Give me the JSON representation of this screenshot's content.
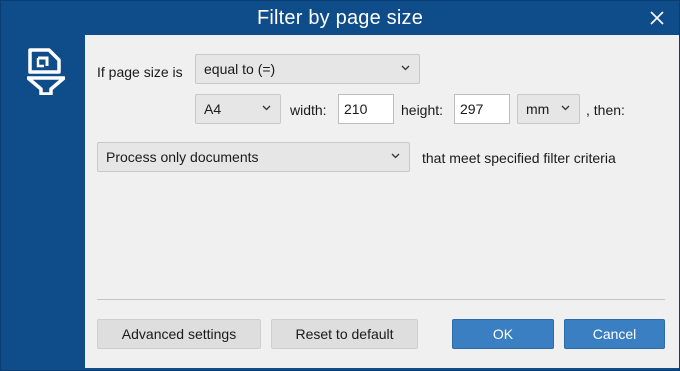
{
  "window": {
    "title": "Filter by page size",
    "accent": "#0f4c8a"
  },
  "icons": {
    "close": "close-icon",
    "app": "filter-page-icon",
    "chevron": "chevron-down-icon"
  },
  "condition": {
    "prefix_label": "If page size is",
    "operator_value": "equal to (=)"
  },
  "size": {
    "preset_value": "A4",
    "width_label": "width:",
    "width_value": "210",
    "height_label": "height:",
    "height_value": "297",
    "unit_value": "mm",
    "suffix_label": ", then:"
  },
  "action": {
    "mode_value": "Process only documents",
    "trailing_label": "that meet specified filter criteria"
  },
  "buttons": {
    "advanced": "Advanced settings",
    "reset": "Reset to default",
    "ok": "OK",
    "cancel": "Cancel"
  }
}
